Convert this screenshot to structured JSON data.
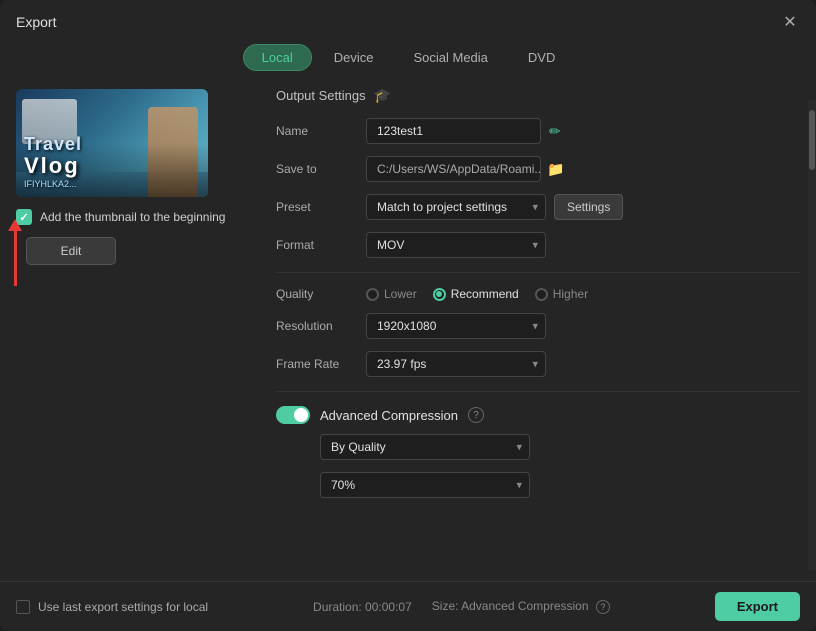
{
  "window": {
    "title": "Export",
    "close_label": "✕"
  },
  "tabs": [
    {
      "id": "local",
      "label": "Local",
      "active": true
    },
    {
      "id": "device",
      "label": "Device",
      "active": false
    },
    {
      "id": "social_media",
      "label": "Social Media",
      "active": false
    },
    {
      "id": "dvd",
      "label": "DVD",
      "active": false
    }
  ],
  "left_panel": {
    "thumbnail": {
      "title1": "Travel",
      "title2": "Vlog",
      "subtitle": "IFIYHLKA2..."
    },
    "checkbox_label": "Add the thumbnail to the beginning",
    "edit_button": "Edit"
  },
  "right_panel": {
    "section_title": "Output Settings",
    "fields": {
      "name_label": "Name",
      "name_value": "123test1",
      "save_to_label": "Save to",
      "save_to_value": "C:/Users/WS/AppData/Roami...",
      "preset_label": "Preset",
      "preset_value": "Match to project settings",
      "settings_button": "Settings",
      "format_label": "Format",
      "format_value": "MOV",
      "quality_label": "Quality",
      "quality_options": [
        {
          "id": "lower",
          "label": "Lower",
          "selected": false
        },
        {
          "id": "recommend",
          "label": "Recommend",
          "selected": true
        },
        {
          "id": "higher",
          "label": "Higher",
          "selected": false
        }
      ],
      "resolution_label": "Resolution",
      "resolution_value": "1920x1080",
      "frame_rate_label": "Frame Rate",
      "frame_rate_value": "23.97 fps"
    },
    "advanced": {
      "label": "Advanced Compression",
      "enabled": true,
      "compression_type_label": "By Quality",
      "quality_percent_label": "70%"
    }
  },
  "footer": {
    "checkbox_label": "Use last export settings for local",
    "duration_label": "Duration: 00:00:07",
    "size_label": "Size: Advanced Compression",
    "export_button": "Export"
  },
  "icons": {
    "close": "✕",
    "output_settings": "🎓",
    "ai": "✏",
    "folder": "📁",
    "help": "?"
  }
}
